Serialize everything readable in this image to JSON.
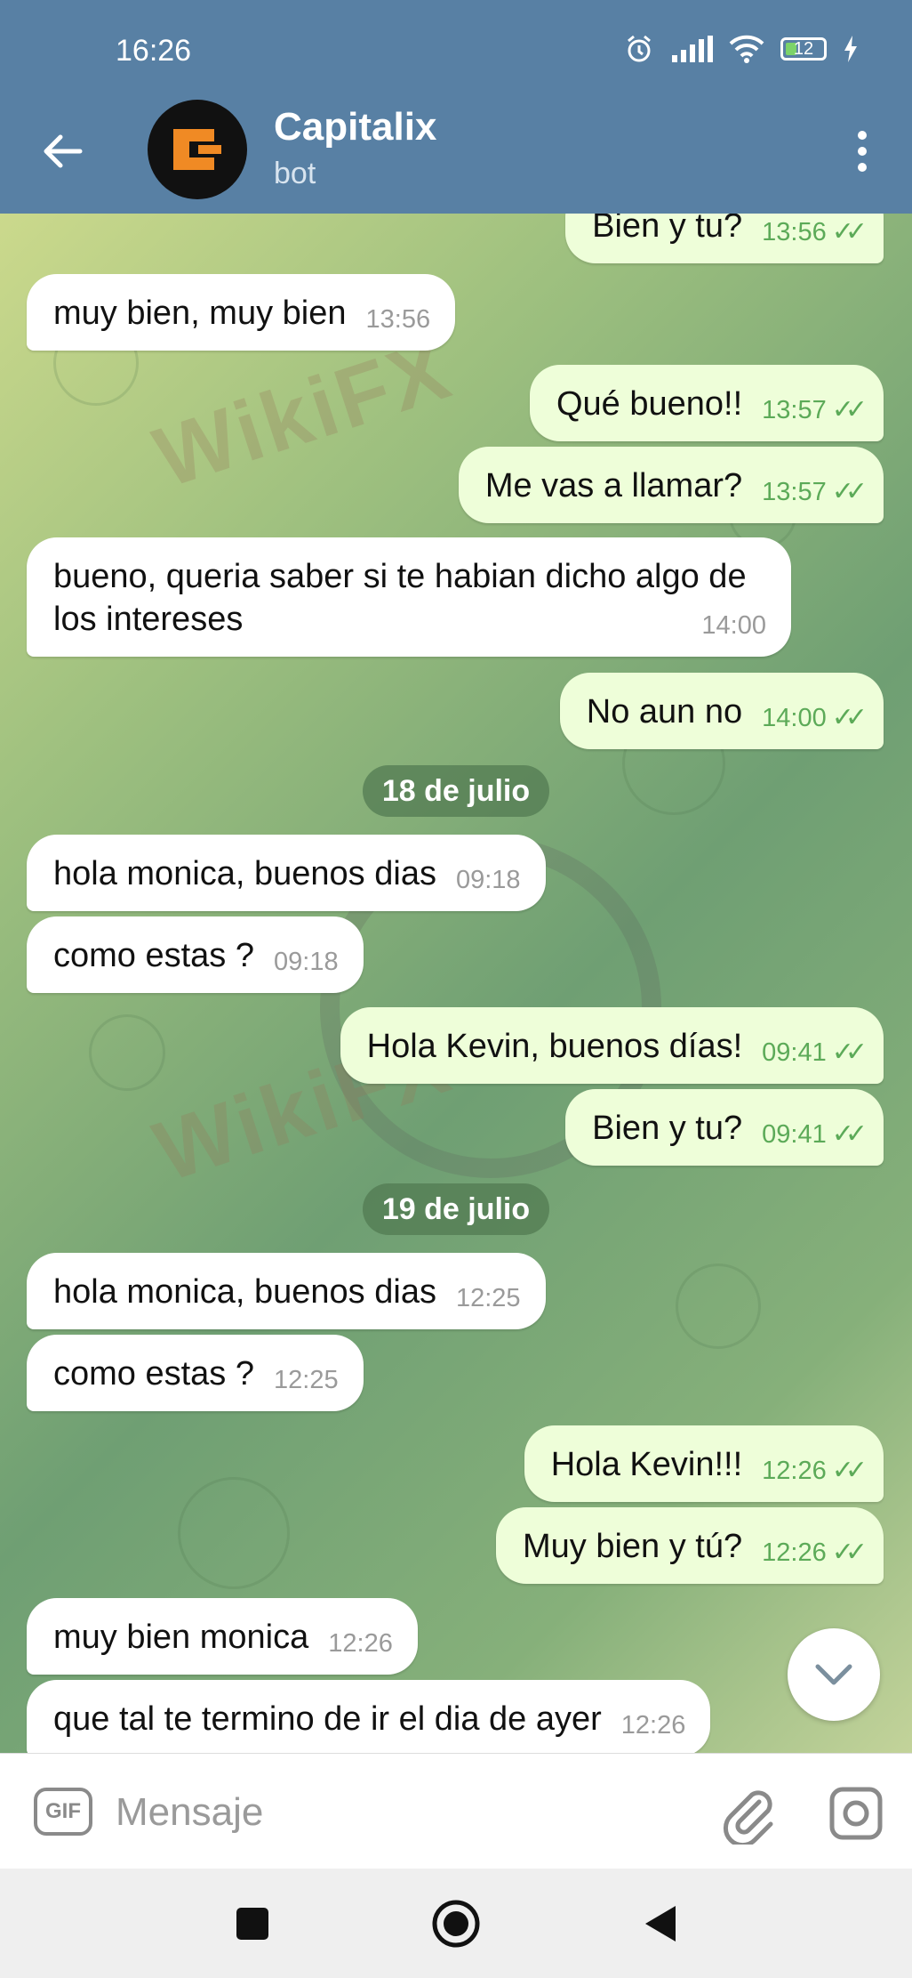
{
  "status_bar": {
    "time": "16:26",
    "battery": "12"
  },
  "header": {
    "title": "Capitalix",
    "subtitle": "bot"
  },
  "colors": {
    "header": "#5880a4",
    "outgoing_bubble": "#eefed9",
    "incoming_bubble": "#ffffff",
    "tick_green": "#5caa58",
    "logo_orange": "#f08a24"
  },
  "messages": [
    {
      "dir": "out",
      "text": "Bien y tu?",
      "time": "13:56",
      "read": true
    },
    {
      "dir": "in",
      "text": "muy bien, muy bien",
      "time": "13:56"
    },
    {
      "dir": "out",
      "text": "Qué bueno!!",
      "time": "13:57",
      "read": true
    },
    {
      "dir": "out",
      "text": "Me vas a llamar?",
      "time": "13:57",
      "read": true
    },
    {
      "dir": "in",
      "text": "bueno, queria saber si te habian dicho algo de los intereses",
      "time": "14:00"
    },
    {
      "dir": "out",
      "text": "No aun no",
      "time": "14:00",
      "read": true
    },
    {
      "dir": "in",
      "text": "hola monica, buenos dias",
      "time": "09:18"
    },
    {
      "dir": "in",
      "text": "como estas ?",
      "time": "09:18"
    },
    {
      "dir": "out",
      "text": "Hola Kevin, buenos días!",
      "time": "09:41",
      "read": true
    },
    {
      "dir": "out",
      "text": "Bien y tu?",
      "time": "09:41",
      "read": true
    },
    {
      "dir": "in",
      "text": "hola monica, buenos dias",
      "time": "12:25"
    },
    {
      "dir": "in",
      "text": "como estas ?",
      "time": "12:25"
    },
    {
      "dir": "out",
      "text": "Hola Kevin!!!",
      "time": "12:26",
      "read": true
    },
    {
      "dir": "out",
      "text": "Muy bien y tú?",
      "time": "12:26",
      "read": true
    },
    {
      "dir": "in",
      "text": "muy bien monica",
      "time": "12:26"
    },
    {
      "dir": "in",
      "text": "que tal te termino de ir el dia de ayer",
      "time": "12:26"
    }
  ],
  "dates": [
    "18 de julio",
    "19 de julio"
  ],
  "input": {
    "gif_label": "GIF",
    "placeholder": "Mensaje"
  },
  "watermark": "WikiFX"
}
